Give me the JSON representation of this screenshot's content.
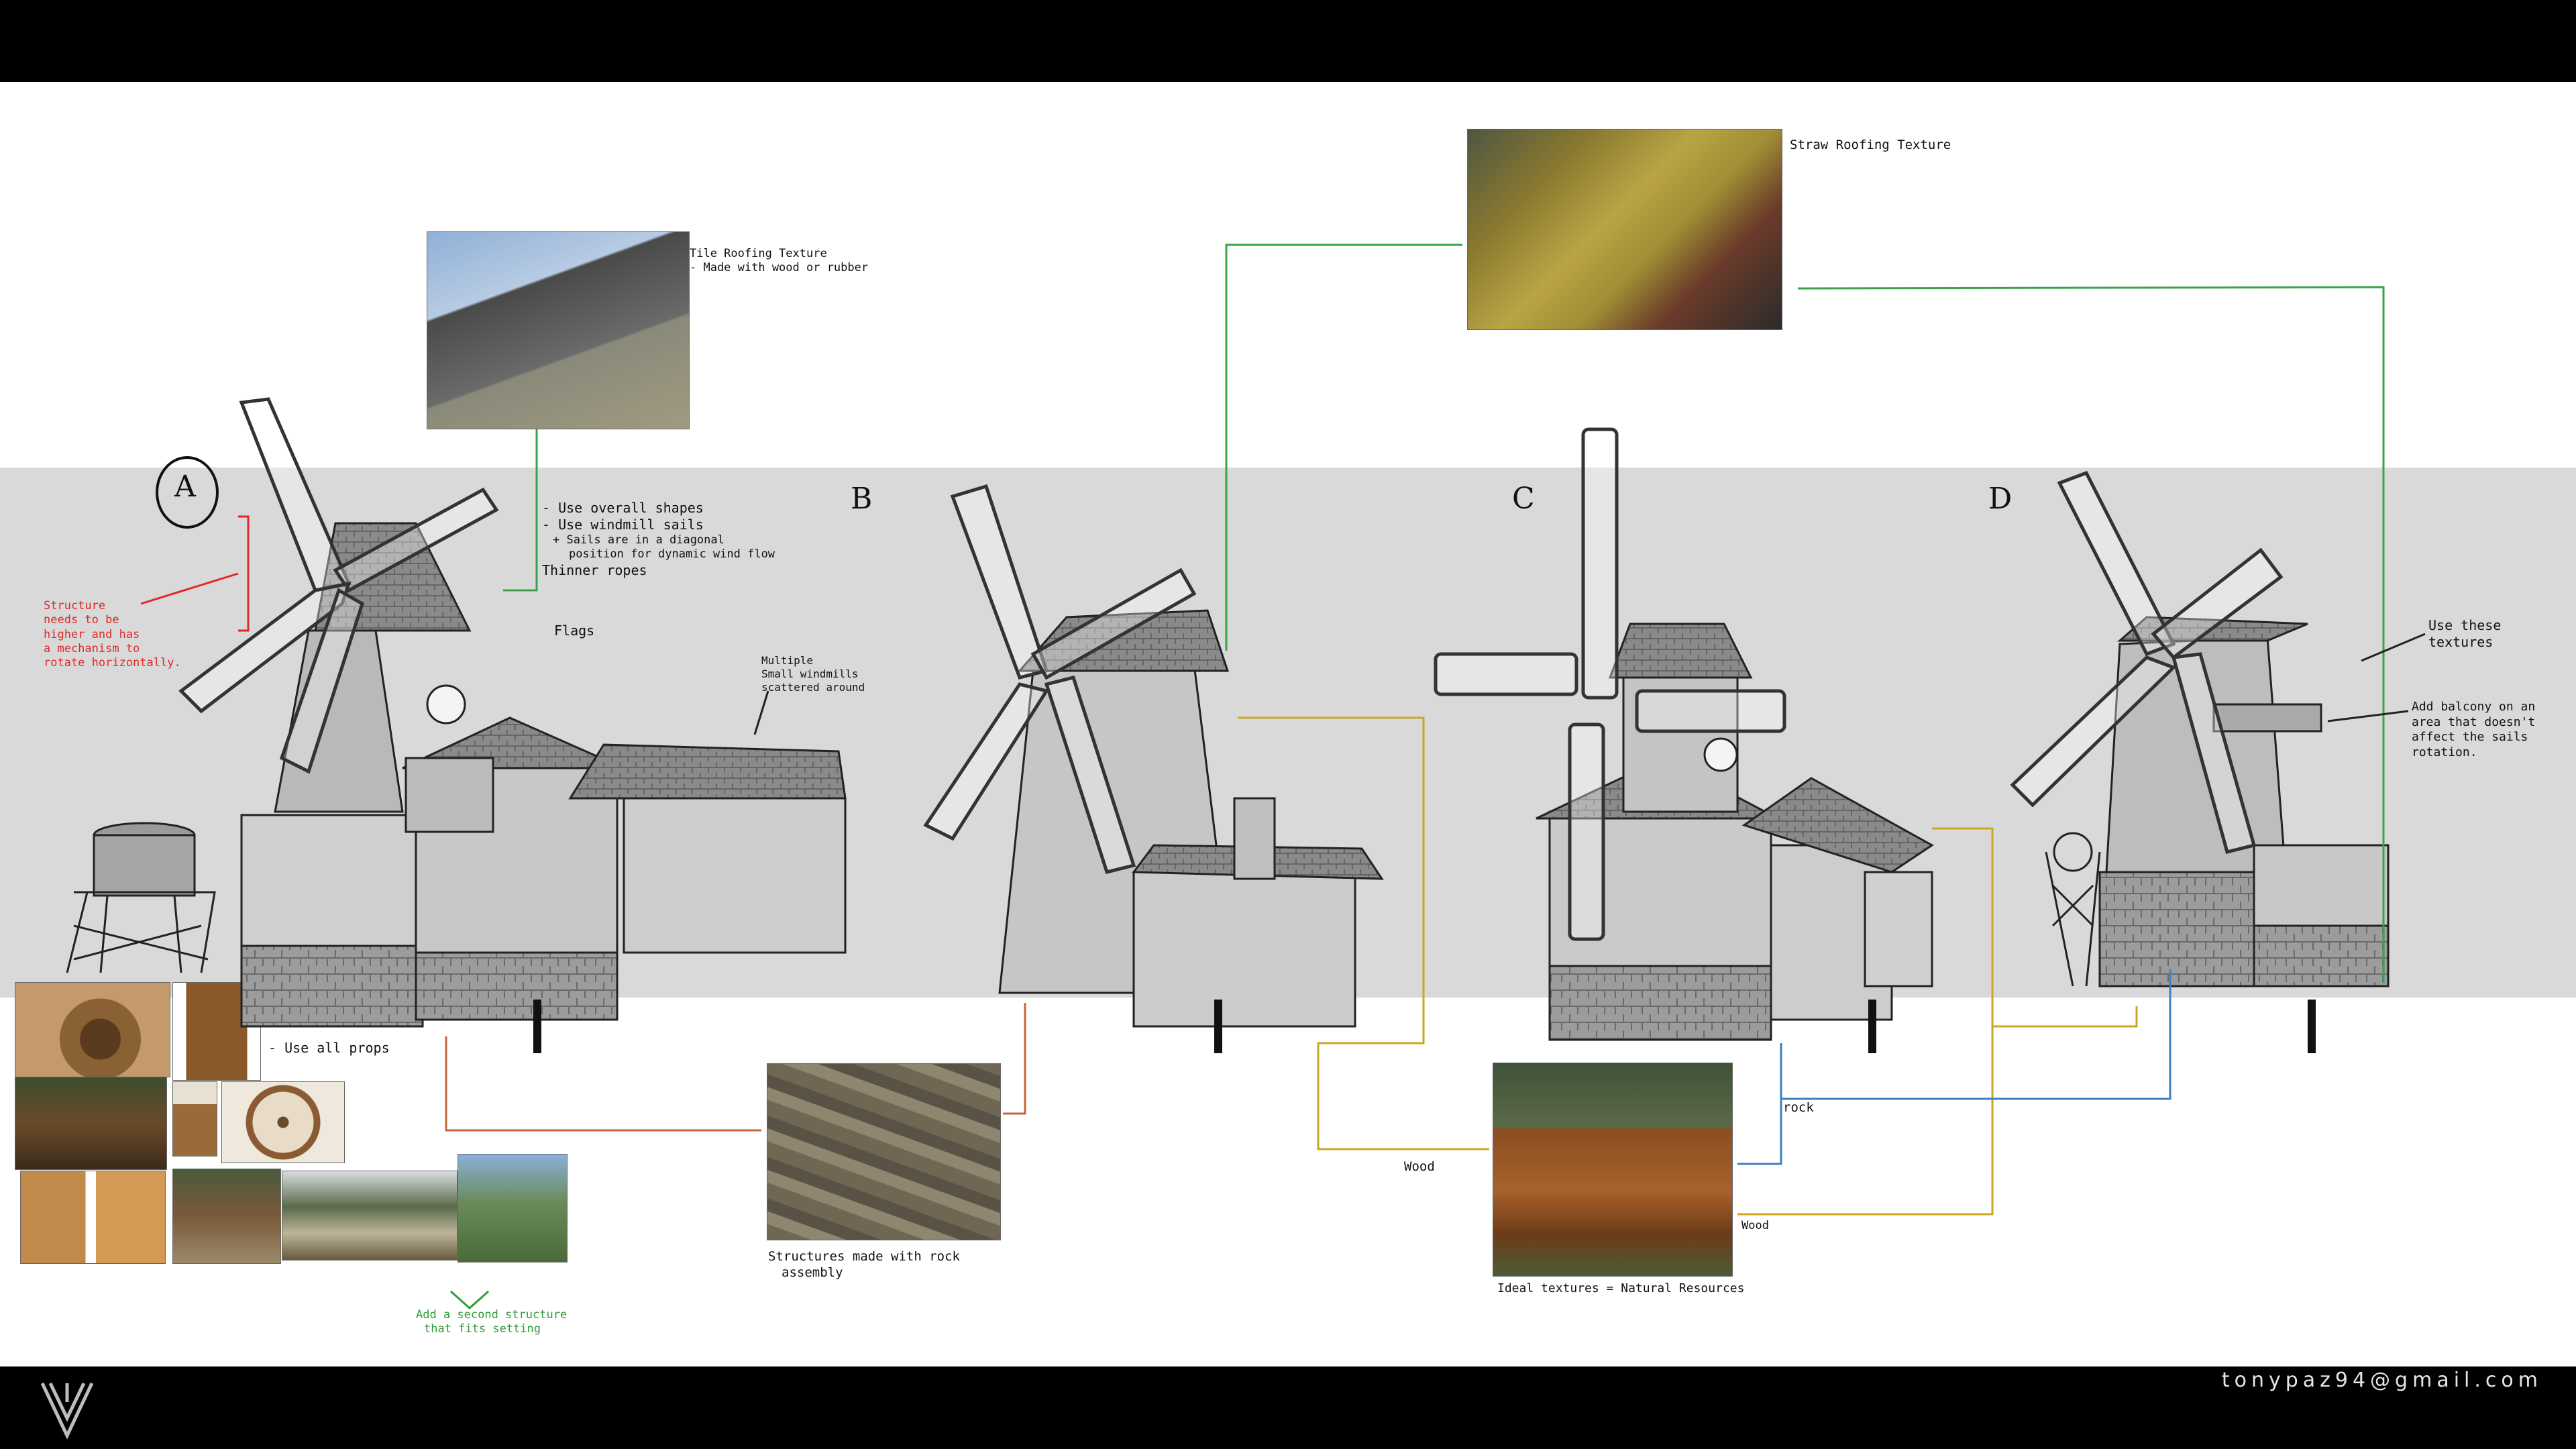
{
  "sheet": {
    "letters": [
      "A",
      "B",
      "C",
      "D"
    ],
    "notes": {
      "tile_title": "Tile Roofing Texture",
      "tile_sub": "- Made with wood or rubber",
      "straw": "Straw Roofing Texture",
      "overall_1": "- Use overall shapes",
      "overall_2": "- Use windmill sails",
      "overall_3": "+ Sails are in a diagonal",
      "overall_4": "position for dynamic wind flow",
      "ropes": "Thinner ropes",
      "flags": "Flags",
      "multiple_1": "Multiple",
      "multiple_2": "Small windmills",
      "multiple_3": "scattered around",
      "red_1": "Structure",
      "red_2": "needs to be",
      "red_3": "higher and has",
      "red_4": "a mechanism to",
      "red_5": "rotate horizontally.",
      "props": "- Use all props",
      "rock_assembly_1": "Structures made with rock",
      "rock_assembly_2": "assembly",
      "green_1": "Add a second structure",
      "green_2": "that fits setting",
      "use_textures_1": "Use these",
      "use_textures_2": "textures",
      "balcony_1": "Add balcony on an",
      "balcony_2": "area that doesn't",
      "balcony_3": "affect the sails",
      "balcony_4": "rotation.",
      "rock": "rock",
      "wood_left": "Wood",
      "wood_right": "Wood",
      "ideal": "Ideal textures = Natural Resources"
    },
    "email": "tonypaz94@gmail.com"
  },
  "colors": {
    "background": "#ffffff",
    "band": "#d9d9d9",
    "frame": "#000000",
    "green_line": "#3aa34a",
    "yellow_line": "#c9a723",
    "orange_line": "#c8643a",
    "blue_line": "#3b7fc4",
    "red_note": "#e0282b"
  }
}
